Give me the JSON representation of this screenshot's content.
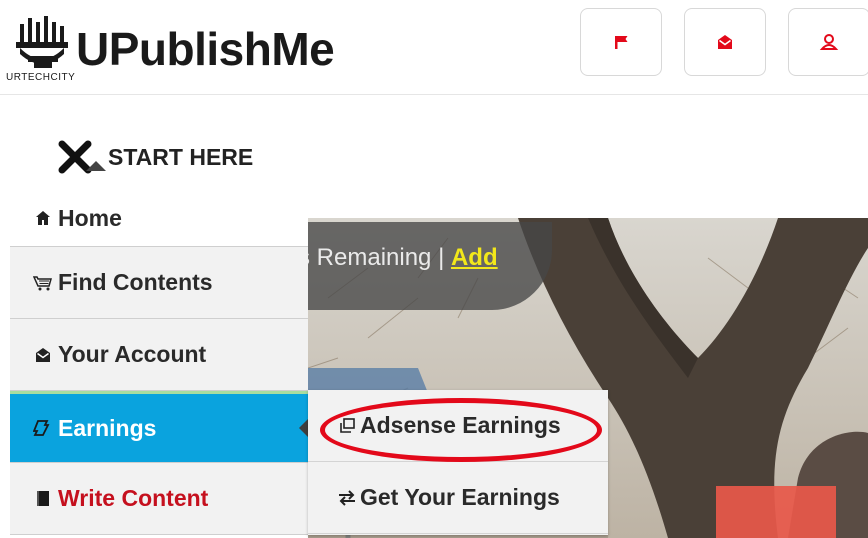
{
  "brand": {
    "name": "UPublishMe",
    "tagline": "URTECHCITY"
  },
  "header": {
    "buttons": [
      {
        "icon": "flag-icon",
        "color": "#e3091a"
      },
      {
        "icon": "envelope-icon",
        "color": "#e3091a"
      },
      {
        "icon": "user-icon",
        "color": "#e3091a"
      }
    ]
  },
  "start_here": {
    "label": "START HERE"
  },
  "notice": {
    "text": "s Remaining | ",
    "link": "Add"
  },
  "menu": {
    "items": [
      {
        "label": "Home",
        "icon": "home-icon"
      },
      {
        "label": "Find Contents",
        "icon": "cart-icon"
      },
      {
        "label": "Your Account",
        "icon": "envelope-icon"
      },
      {
        "label": "Earnings",
        "icon": "pencil-icon",
        "active": true
      },
      {
        "label": "Write Content",
        "icon": "book-icon"
      }
    ]
  },
  "submenu": {
    "items": [
      {
        "label": "Adsense Earnings",
        "icon": "external-link-icon",
        "highlighted": true
      },
      {
        "label": "Get Your Earnings",
        "icon": "transfer-icon"
      }
    ]
  },
  "colors": {
    "active_menu": "#0aa3de",
    "write_content": "#c5101e",
    "highlight": "#e3091a",
    "notice_link": "#f2e71a"
  }
}
